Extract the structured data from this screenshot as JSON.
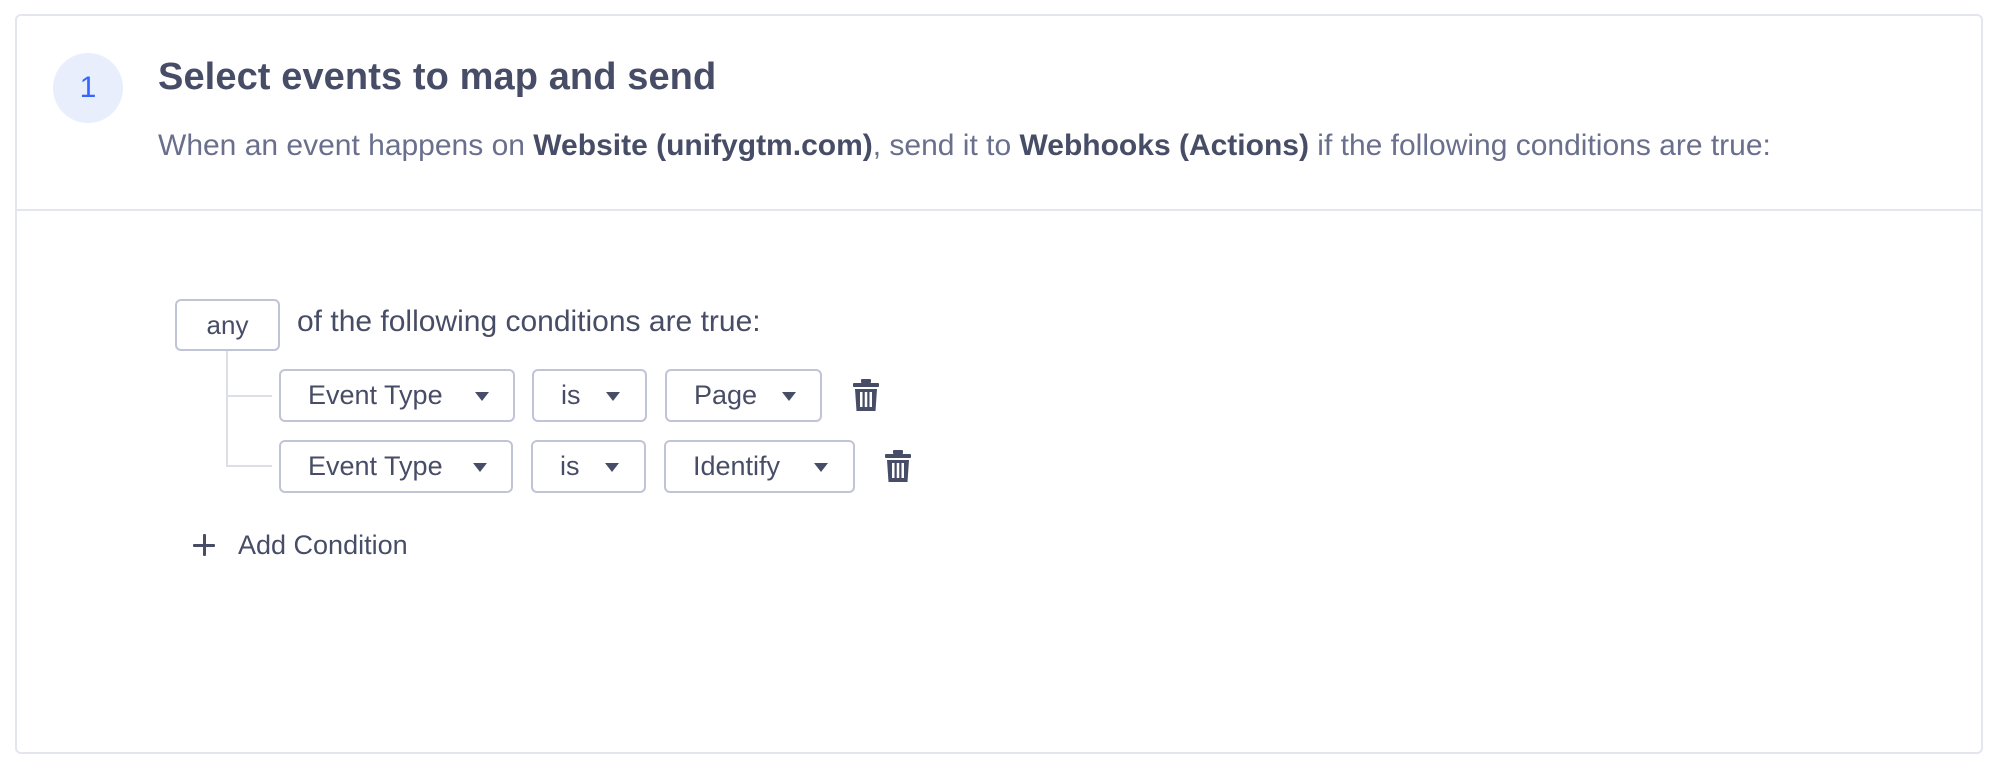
{
  "step": {
    "number": "1",
    "title": "Select events to map and send",
    "desc_prefix": "When an event happens on ",
    "source": "Website (unifygtm.com)",
    "desc_middle": ", send it to ",
    "destination": "Webhooks (Actions)",
    "desc_suffix": " if the following conditions are true:"
  },
  "conditions": {
    "match_mode": "any",
    "match_suffix": "of the following conditions are true:",
    "rows": [
      {
        "field": "Event Type",
        "operator": "is",
        "value": "Page"
      },
      {
        "field": "Event Type",
        "operator": "is",
        "value": "Identify"
      }
    ],
    "add_label": "Add Condition"
  },
  "icons": {
    "step": "step-number-badge",
    "caret": "caret-down-icon",
    "delete": "trash-icon",
    "add": "plus-icon"
  },
  "colors": {
    "accent": "#3366ff",
    "accent_bg": "#e8eefc",
    "text": "#474d66",
    "muted": "#696f8c",
    "border": "#c1c4d6"
  }
}
